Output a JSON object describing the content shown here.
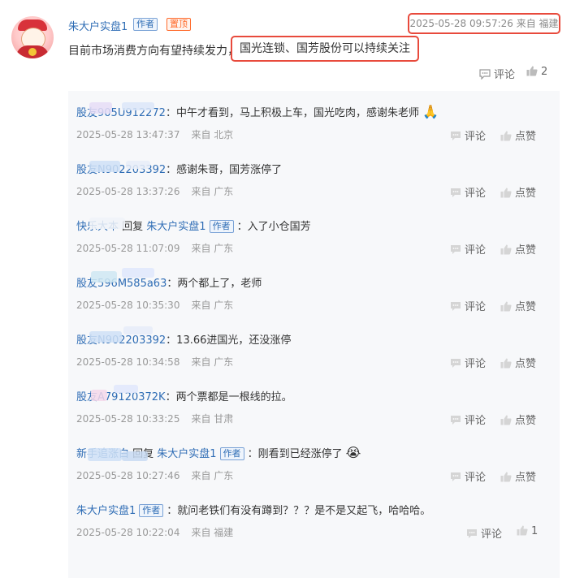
{
  "post": {
    "username": "朱大户实盘1",
    "author_tag": "作者",
    "pinned_tag": "置顶",
    "time": "2025-05-28 09:57:26 来自 福建",
    "text_prefix": "目前市场消费方向有望持续发力，",
    "text_highlight": "国光连锁、国芳股份可以持续关注",
    "comment_label": "评论",
    "like_count": "2"
  },
  "colors": {
    "link_blue": "#2f6db5",
    "highlight_red": "#e84a3c",
    "pinned_orange": "#ff6a2b",
    "reply_bg": "#f7f8fa"
  },
  "replies": [
    {
      "name": "股友905U912272",
      "reply_to": "",
      "text": "：中午才看到，马上积极上车，国光吃肉，感谢朱老师",
      "emoji": "🙏",
      "time": "2025-05-28 13:47:37",
      "loc": "来自 北京",
      "comment": "评论",
      "like": "点赞"
    },
    {
      "name": "股友N902203392",
      "reply_to": "",
      "text": "：感谢朱哥，国芳涨停了",
      "emoji": "",
      "time": "2025-05-28 13:37:26",
      "loc": "来自 广东",
      "comment": "评论",
      "like": "点赞"
    },
    {
      "name": "快乐大本",
      "reply_to": "朱大户实盘1",
      "reply_word": "回复",
      "author_tag": "作者",
      "text": "：入了小仓国芳",
      "emoji": "",
      "time": "2025-05-28 11:07:09",
      "loc": "来自 广东",
      "comment": "评论",
      "like": "点赞"
    },
    {
      "name": "股友596M585a63",
      "reply_to": "",
      "text": "：两个都上了，老师",
      "emoji": "",
      "time": "2025-05-28 10:35:30",
      "loc": "来自 广东",
      "comment": "评论",
      "like": "点赞"
    },
    {
      "name": "股友N902203392",
      "reply_to": "",
      "text": "：13.66进国光，还没涨停",
      "emoji": "",
      "time": "2025-05-28 10:34:58",
      "loc": "来自 广东",
      "comment": "评论",
      "like": "点赞"
    },
    {
      "name": "股友A79120372K",
      "reply_to": "",
      "text": "：两个票都是一根线的拉。",
      "emoji": "",
      "time": "2025-05-28 10:33:25",
      "loc": "来自 甘肃",
      "comment": "评论",
      "like": "点赞"
    },
    {
      "name": "新手追涨白",
      "reply_to": "朱大户实盘1",
      "reply_word": "回复",
      "author_tag": "作者",
      "text": "：刚看到已经涨停了",
      "emoji": "😭",
      "time": "2025-05-28 10:27:46",
      "loc": "来自 广东",
      "comment": "评论",
      "like": "点赞"
    },
    {
      "name": "朱大户实盘1",
      "is_author": true,
      "author_tag": "作者",
      "reply_to": "",
      "text": "：就问老铁们有没有蹲到？？？是不是又起飞，哈哈哈。",
      "emoji": "",
      "time": "2025-05-28 10:22:04",
      "loc": "来自 福建",
      "comment": "评论",
      "like": "1"
    }
  ]
}
